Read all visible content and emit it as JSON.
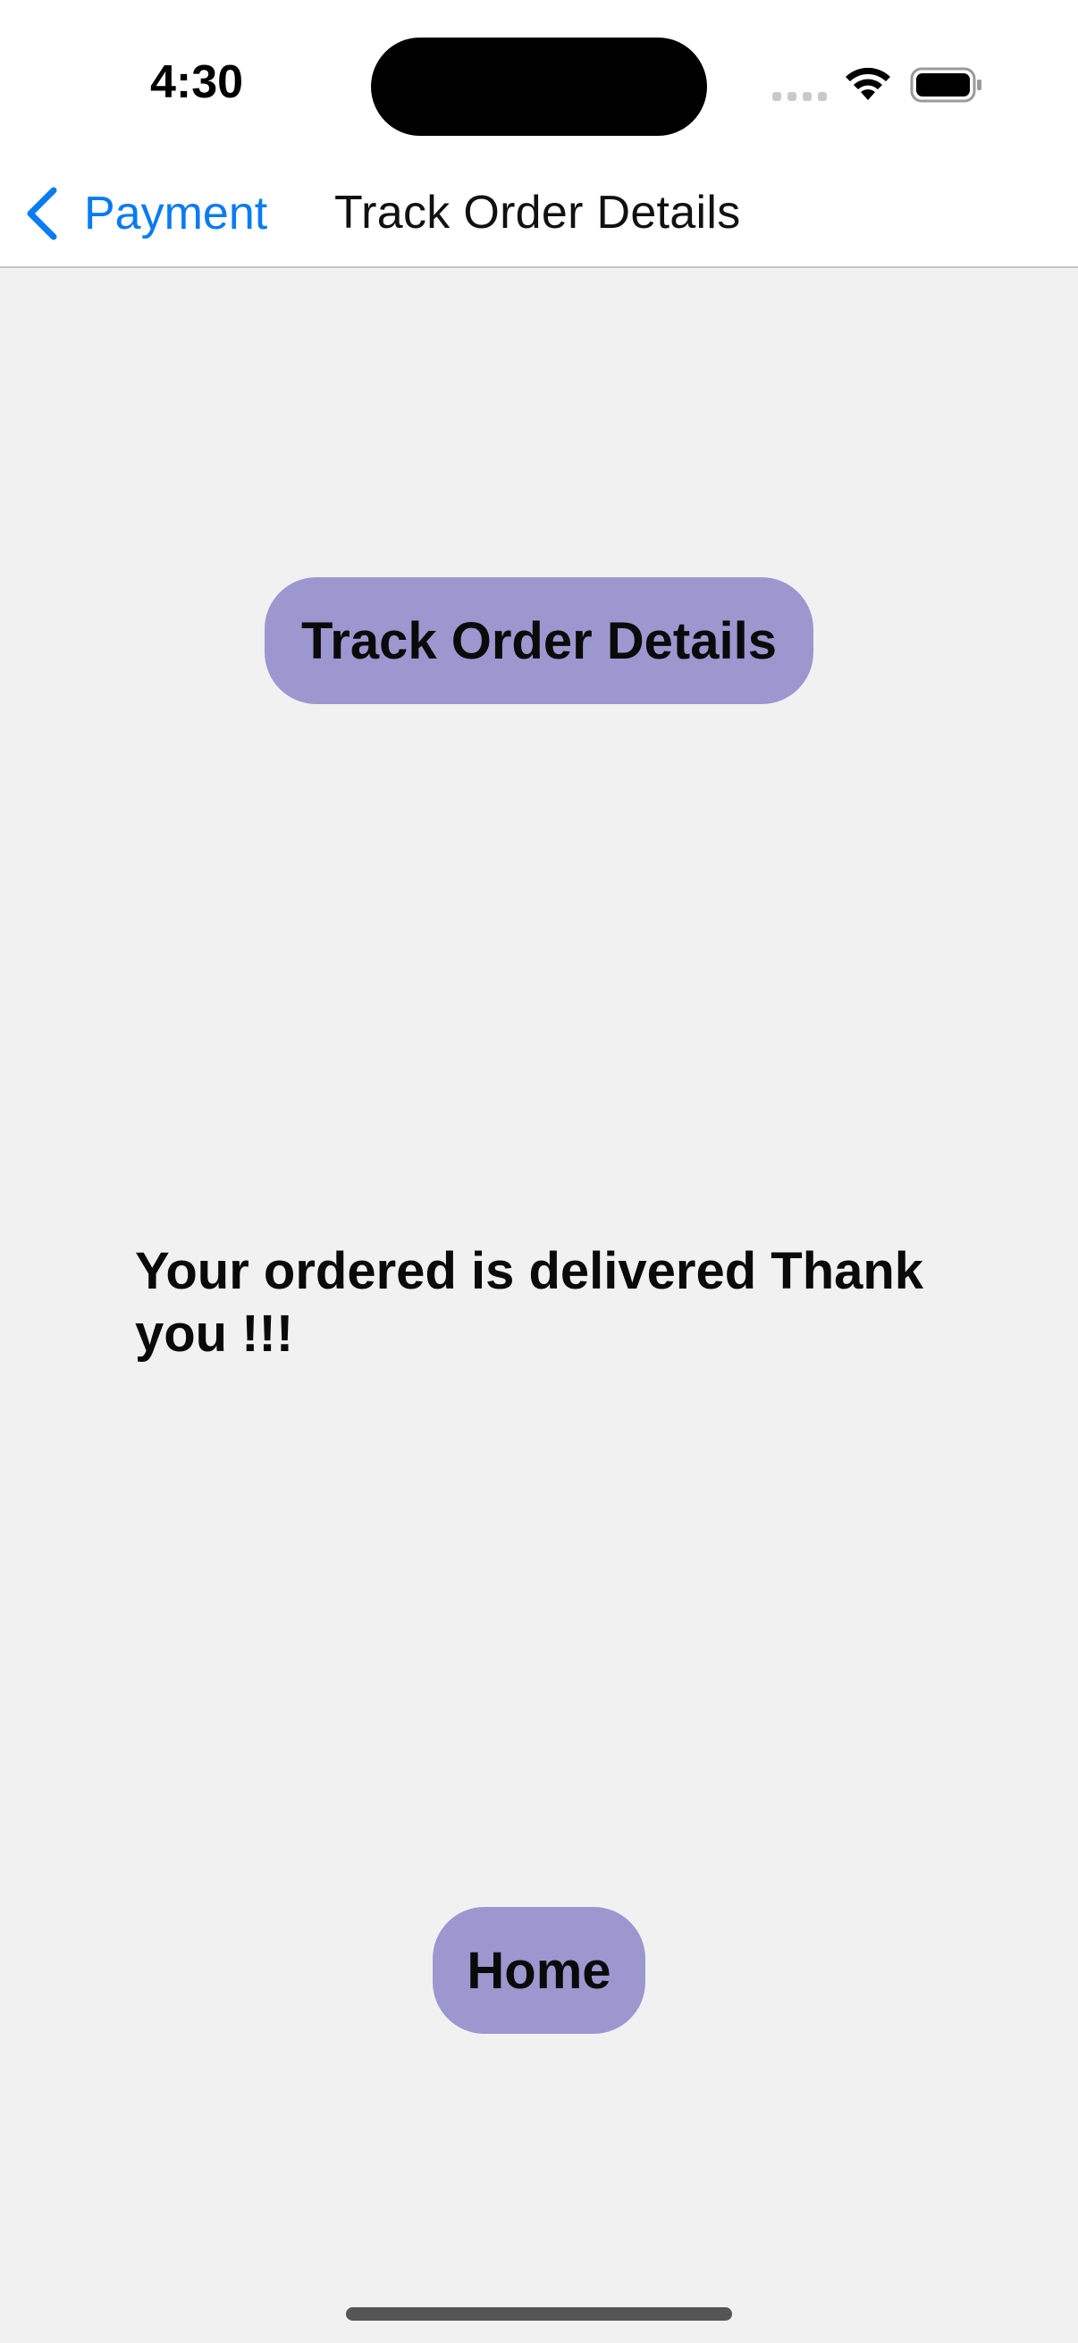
{
  "status_bar": {
    "time": "4:30"
  },
  "nav": {
    "back_label": "Payment",
    "title": "Track Order Details"
  },
  "content": {
    "track_button_label": "Track Order Details",
    "message": "Your ordered is delivered Thank you !!!",
    "home_button_label": "Home"
  },
  "colors": {
    "accent": "#0a7bf0",
    "button_bg": "#9d97d0",
    "page_bg": "#f1f1f1"
  },
  "icons": {
    "back": "chevron-left-icon",
    "wifi": "wifi-icon",
    "battery": "battery-icon",
    "signal": "signal-icon"
  }
}
